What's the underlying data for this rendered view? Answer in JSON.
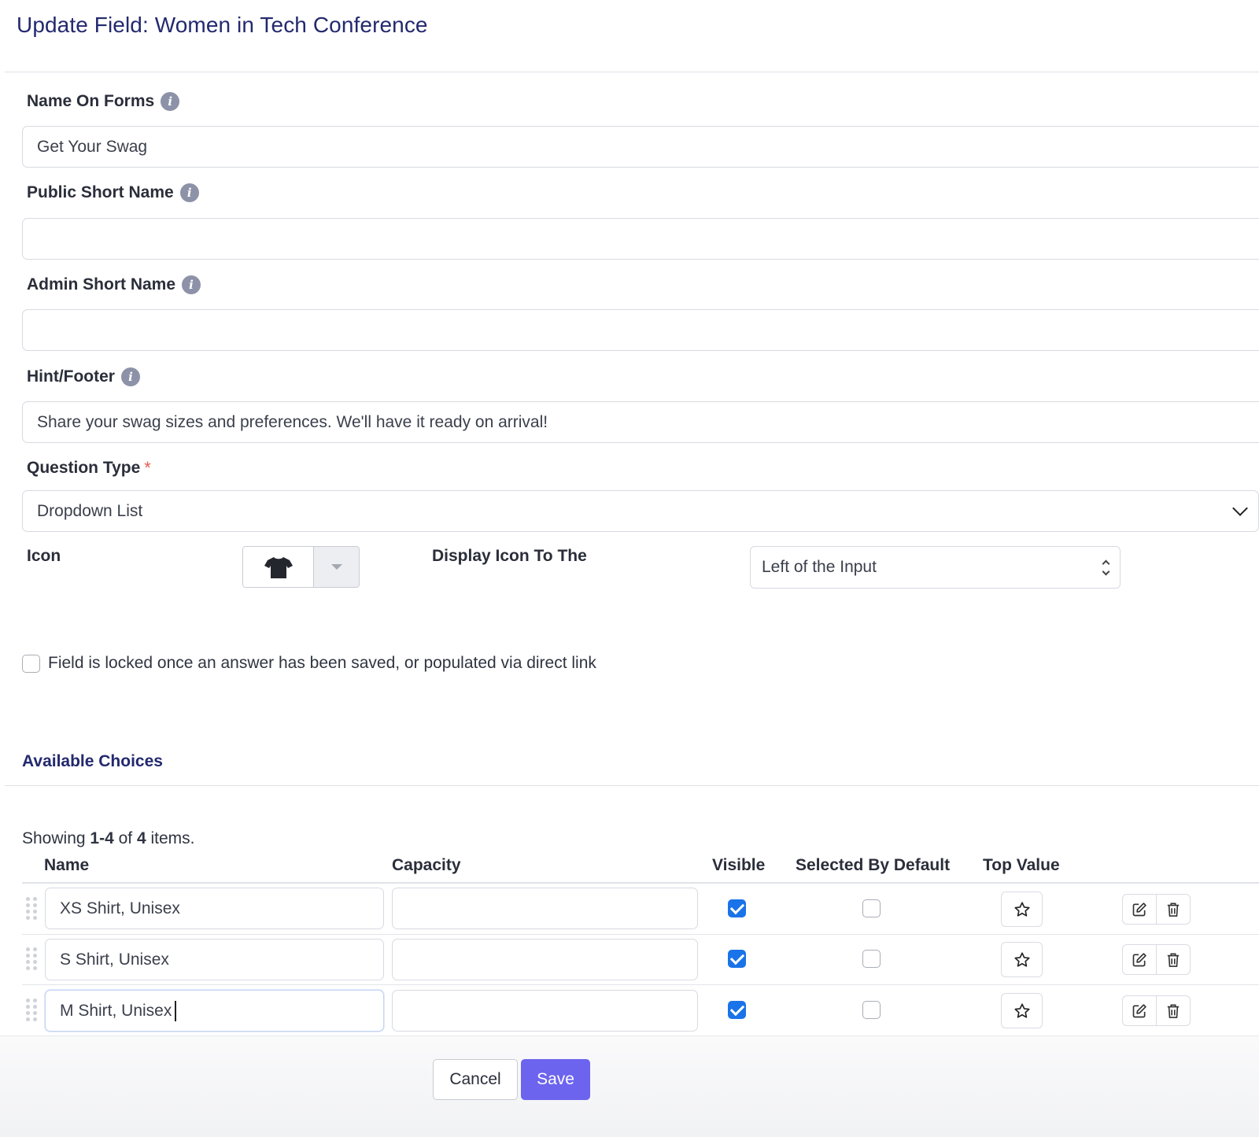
{
  "dialog": {
    "title": "Update Field: Women in Tech Conference"
  },
  "fields": {
    "name_on_forms": {
      "label": "Name On Forms",
      "value": "Get Your Swag"
    },
    "public_short_name": {
      "label": "Public Short Name",
      "value": ""
    },
    "admin_short_name": {
      "label": "Admin Short Name",
      "value": ""
    },
    "hint_footer": {
      "label": "Hint/Footer",
      "value": "Share your swag sizes and preferences. We'll have it ready on arrival!"
    },
    "question_type": {
      "label": "Question Type",
      "required_mark": "*",
      "value": "Dropdown List"
    },
    "icon": {
      "label": "Icon",
      "selected_icon": "t-shirt-icon"
    },
    "display_icon": {
      "label": "Display Icon To The",
      "value": "Left of the Input"
    },
    "locked": {
      "label": "Field is locked once an answer has been saved, or populated via direct link",
      "checked": false
    }
  },
  "choices": {
    "section_title": "Available Choices",
    "summary": {
      "prefix": "Showing ",
      "range": "1-4",
      "of": " of ",
      "total": "4",
      "suffix": " items."
    },
    "columns": {
      "name": "Name",
      "capacity": "Capacity",
      "visible": "Visible",
      "selected_by_default": "Selected By Default",
      "top_value": "Top Value"
    },
    "rows": [
      {
        "name": "XS Shirt, Unisex",
        "capacity": "",
        "visible": true,
        "selected_by_default": false
      },
      {
        "name": "S Shirt, Unisex",
        "capacity": "",
        "visible": true,
        "selected_by_default": false
      },
      {
        "name": "M Shirt, Unisex",
        "capacity": "",
        "visible": true,
        "selected_by_default": false
      }
    ]
  },
  "footer": {
    "cancel_label": "Cancel",
    "save_label": "Save"
  },
  "colors": {
    "accent": "#6c63ee",
    "title": "#23296e",
    "checkbox": "#1a73e8",
    "required": "#e35d52"
  }
}
